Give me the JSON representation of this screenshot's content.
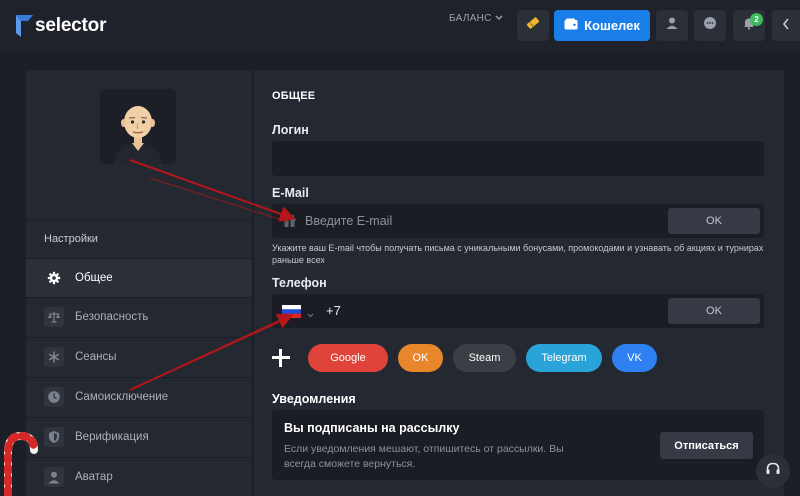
{
  "header": {
    "logo_text": "selector",
    "balance_label": "БАЛАНС",
    "wallet_label": "Кошелек",
    "notification_count": "2",
    "colors": {
      "accent": "#1a7ee8",
      "badge": "#3dbb5c"
    }
  },
  "sidebar": {
    "section_label": "Настройки",
    "items": [
      {
        "label": "Общее",
        "icon": "gear-icon",
        "active": true
      },
      {
        "label": "Безопасность",
        "icon": "scales-icon",
        "active": false
      },
      {
        "label": "Сеансы",
        "icon": "asterisk-icon",
        "active": false
      },
      {
        "label": "Самоисключение",
        "icon": "clock-icon",
        "active": false
      },
      {
        "label": "Верификация",
        "icon": "shield-icon",
        "active": false
      },
      {
        "label": "Аватар",
        "icon": "user-icon",
        "active": false
      }
    ]
  },
  "main": {
    "section_title": "ОБЩЕЕ",
    "login": {
      "label": "Логин",
      "value": ""
    },
    "email": {
      "label": "E-Mail",
      "placeholder": "Введите E-mail",
      "ok_label": "OK",
      "hint": "Укажите ваш E-mail чтобы получать письма с уникальными бонусами, промокодами и узнавать об акциях и турнирах раньше всех"
    },
    "phone": {
      "label": "Телефон",
      "prefix": "+7",
      "ok_label": "OK"
    },
    "socials": [
      {
        "label": "Google",
        "color": "#e0433a"
      },
      {
        "label": "OK",
        "color": "#e8862c"
      },
      {
        "label": "Steam",
        "color": "#3b3e45"
      },
      {
        "label": "Telegram",
        "color": "#2aa3d9"
      },
      {
        "label": "VK",
        "color": "#2f80f0"
      }
    ],
    "notifications": {
      "title": "Уведомления",
      "heading": "Вы подписаны на рассылку",
      "text": "Если уведомления мешают, отпишитесь от рассылки. Вы всегда сможете вернуться.",
      "unsubscribe_label": "Отписаться"
    }
  }
}
